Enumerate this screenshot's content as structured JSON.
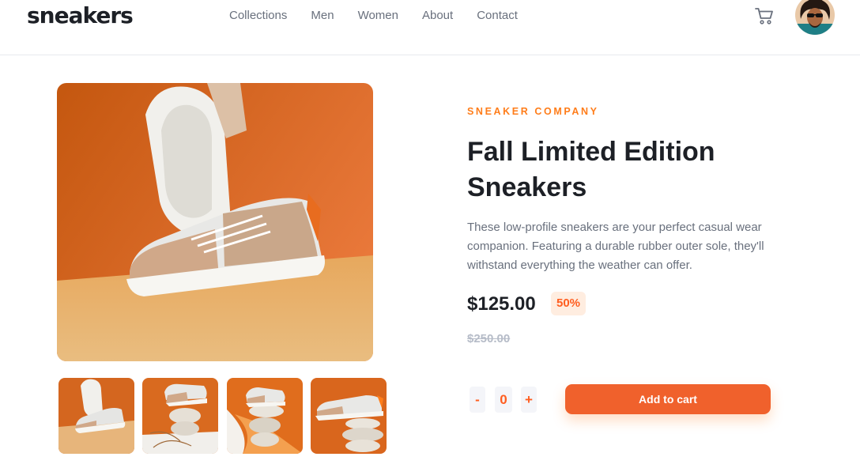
{
  "header": {
    "logo": "sneakers",
    "nav": [
      "Collections",
      "Men",
      "Women",
      "About",
      "Contact"
    ],
    "cart_icon": "cart-icon",
    "avatar_icon": "user-avatar"
  },
  "gallery": {
    "main_image": "white-and-beige-sneakers-on-orange-background",
    "thumbnails": [
      "thumbnail-1",
      "thumbnail-2",
      "thumbnail-3",
      "thumbnail-4"
    ]
  },
  "product": {
    "company": "SNEAKER COMPANY",
    "title": "Fall Limited Edition Sneakers",
    "description": "These low-profile sneakers are your perfect casual wear companion. Featuring a durable rubber outer sole, they'll withstand everything the weather can offer.",
    "price": "$125.00",
    "discount": "50%",
    "old_price": "$250.00"
  },
  "cart_controls": {
    "minus_label": "-",
    "quantity": "0",
    "plus_label": "+",
    "add_label": "Add to cart"
  },
  "colors": {
    "accent": "#ff7d1a",
    "button": "#f0612c",
    "text_dark": "#1d2026",
    "text_gray": "#69707d",
    "muted": "#b6bcc8"
  }
}
